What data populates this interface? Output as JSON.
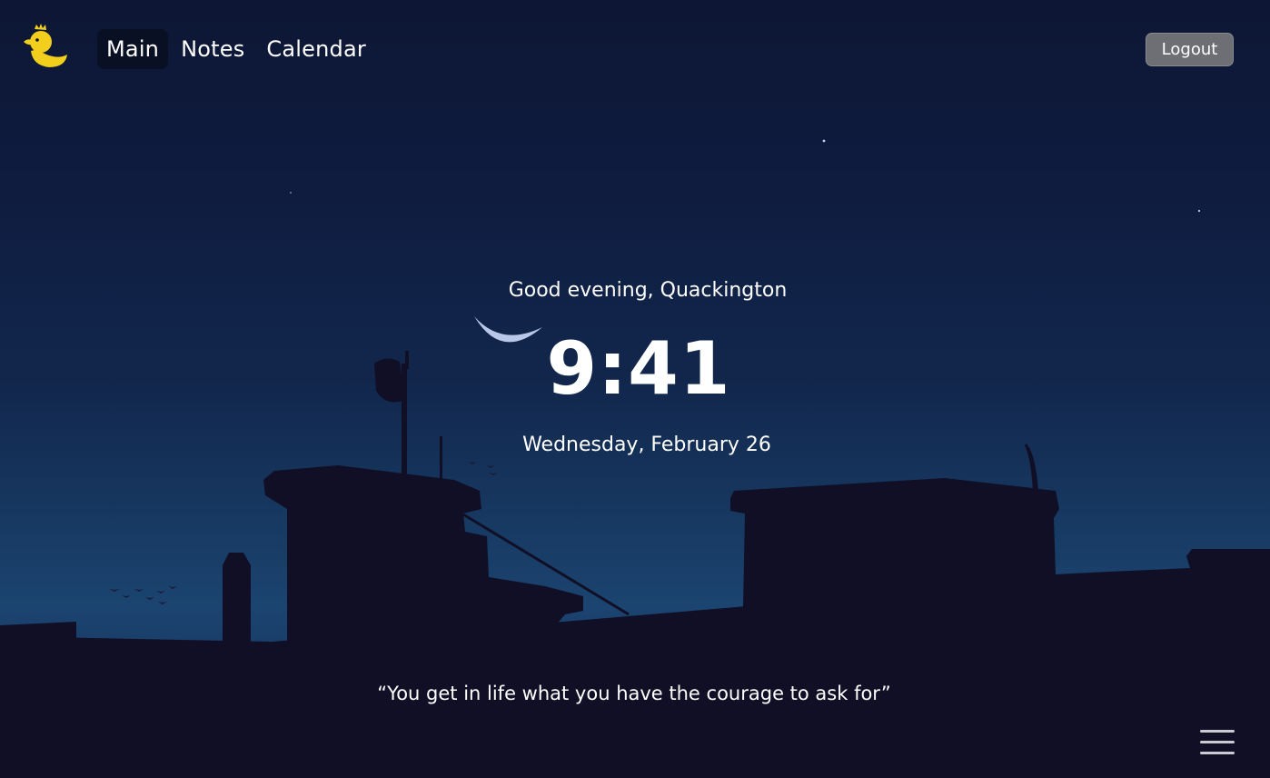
{
  "header": {
    "logo_icon": "duck-with-crown-icon",
    "nav": [
      {
        "label": "Main",
        "active": true
      },
      {
        "label": "Notes",
        "active": false
      },
      {
        "label": "Calendar",
        "active": false
      }
    ],
    "logout_label": "Logout"
  },
  "main": {
    "greeting": "Good evening, Quackington",
    "time": "9:41",
    "date": "Wednesday, February 26",
    "quote": "“You get in life what you have the courage to ask for”"
  },
  "background": {
    "scene": "night-rooftops-with-crescent-moon"
  },
  "footer": {
    "menu_icon": "hamburger-menu-icon"
  },
  "colors": {
    "sky_top": "#0d1634",
    "sky_horizon": "#1b4470",
    "silhouette": "#100f26",
    "logo_yellow": "#f2cf1d",
    "logout_bg": "#6d6f74",
    "moon": "#b9c8e8"
  }
}
